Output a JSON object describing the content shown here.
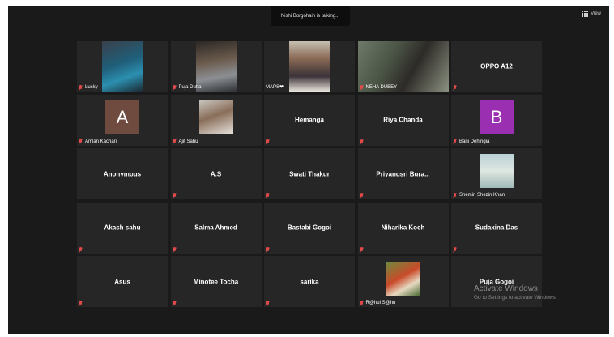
{
  "window": {
    "talking_indicator": "Nishi Borgohain is talking...",
    "view_button_label": "View"
  },
  "participants": [
    {
      "name": "Lucky",
      "video": "photo",
      "muted": true
    },
    {
      "name": "Puja Dutta",
      "video": "photo",
      "muted": true
    },
    {
      "name": "MAPS❤",
      "video": "photo",
      "muted": false
    },
    {
      "name": "NEHA DUBEY",
      "video": "photo",
      "muted": true
    },
    {
      "name": "OPPO A12",
      "video": "none",
      "muted": true
    },
    {
      "name": "Amlan Kachari",
      "video": "avatar",
      "avatar_letter": "A",
      "avatar_color": "#6e4a3f",
      "muted": true
    },
    {
      "name": "Ajit Sahu",
      "video": "small-photo",
      "muted": true
    },
    {
      "name": "Hemanga",
      "video": "none",
      "muted": true
    },
    {
      "name": "Riya Chanda",
      "video": "none",
      "muted": true
    },
    {
      "name": "Bani Dehingia",
      "video": "avatar",
      "avatar_letter": "B",
      "avatar_color": "#9b2fb1",
      "muted": true
    },
    {
      "name": "Anonymous",
      "video": "none",
      "muted": false
    },
    {
      "name": "A.S",
      "video": "none",
      "muted": true
    },
    {
      "name": "Swati Thakur",
      "video": "none",
      "muted": true
    },
    {
      "name": "Priyangsri  Bura...",
      "video": "none",
      "muted": true
    },
    {
      "name": "Shemin Shezin Khan",
      "video": "small-photo",
      "muted": true
    },
    {
      "name": "Akash sahu",
      "video": "none",
      "muted": true
    },
    {
      "name": "Salma Ahmed",
      "video": "none",
      "muted": true
    },
    {
      "name": "Bastabi Gogoi",
      "video": "none",
      "muted": true
    },
    {
      "name": "Niharika Koch",
      "video": "none",
      "muted": true
    },
    {
      "name": "Sudaxina Das",
      "video": "none",
      "muted": true
    },
    {
      "name": "Asus",
      "video": "none",
      "muted": true
    },
    {
      "name": "Minotee Tocha",
      "video": "none",
      "muted": true
    },
    {
      "name": "sarika",
      "video": "none",
      "muted": true
    },
    {
      "name": "R@hul S@hu",
      "video": "small-photo",
      "muted": true
    },
    {
      "name": "Puja Gogoi",
      "video": "none",
      "muted": false
    }
  ],
  "watermark": {
    "title": "Activate Windows",
    "subtitle": "Go to Settings to activate Windows."
  },
  "colors": {
    "mic_muted": "#e04a4a",
    "tile_bg": "#262626",
    "screen_bg": "#1a1a1a"
  }
}
